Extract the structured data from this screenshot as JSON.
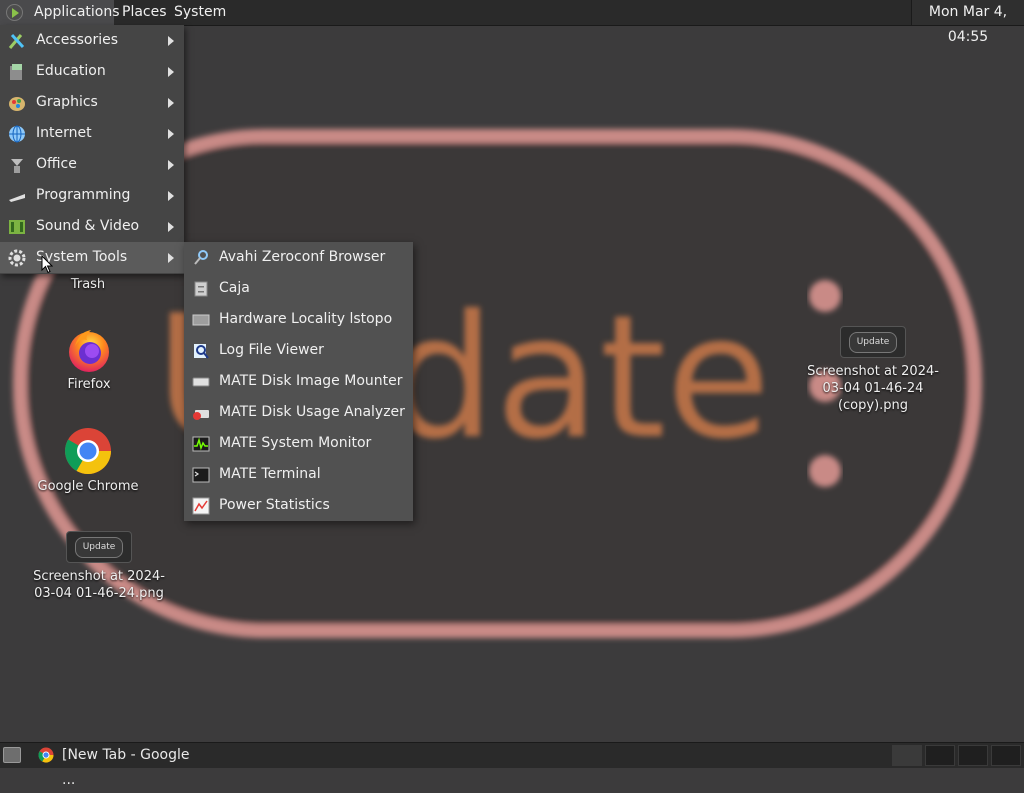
{
  "top_panel": {
    "applications_label": "Applications",
    "places_label": "Places",
    "system_label": "System",
    "clock": "Mon Mar  4, 04:55"
  },
  "main_menu": {
    "items": [
      {
        "label": "Accessories",
        "icon": "accessories-icon",
        "active": false
      },
      {
        "label": "Education",
        "icon": "education-icon",
        "active": false
      },
      {
        "label": "Graphics",
        "icon": "graphics-icon",
        "active": false
      },
      {
        "label": "Internet",
        "icon": "internet-icon",
        "active": false
      },
      {
        "label": "Office",
        "icon": "office-icon",
        "active": false
      },
      {
        "label": "Programming",
        "icon": "programming-icon",
        "active": false
      },
      {
        "label": "Sound & Video",
        "icon": "sound-video-icon",
        "active": false
      },
      {
        "label": "System Tools",
        "icon": "system-tools-icon",
        "active": true
      }
    ]
  },
  "system_tools_submenu": {
    "items": [
      {
        "label": "Avahi Zeroconf Browser",
        "icon": "avahi-icon"
      },
      {
        "label": "Caja",
        "icon": "file-manager-icon"
      },
      {
        "label": "Hardware Locality lstopo",
        "icon": "hardware-icon"
      },
      {
        "label": "Log File Viewer",
        "icon": "log-viewer-icon"
      },
      {
        "label": "MATE Disk Image Mounter",
        "icon": "disk-mounter-icon"
      },
      {
        "label": "MATE Disk Usage Analyzer",
        "icon": "disk-usage-icon"
      },
      {
        "label": "MATE System Monitor",
        "icon": "system-monitor-icon"
      },
      {
        "label": "MATE Terminal",
        "icon": "terminal-icon"
      },
      {
        "label": "Power Statistics",
        "icon": "power-stats-icon"
      }
    ]
  },
  "desktop": {
    "trash_label": "Trash",
    "firefox_label": "Firefox",
    "chrome_label": "Google Chrome",
    "screenshot1_label_line1": "Screenshot at 2024-",
    "screenshot1_label_line2": "03-04 01-46-24.png",
    "screenshot2_label_line1": "Screenshot at 2024-",
    "screenshot2_label_line2": "03-04 01-46-24",
    "screenshot2_label_line3": "(copy).png",
    "thumb_text": "Update"
  },
  "bottom_panel": {
    "task_label": "[New Tab - Google ..."
  },
  "colors": {
    "panel": "#2a2a2a",
    "menu_bg": "#454545",
    "submenu_bg": "#515151",
    "active_item": "#5b5b5b",
    "wallpaper_outline": "#c98a86",
    "wallpaper_bg": "#3c3b3c"
  }
}
